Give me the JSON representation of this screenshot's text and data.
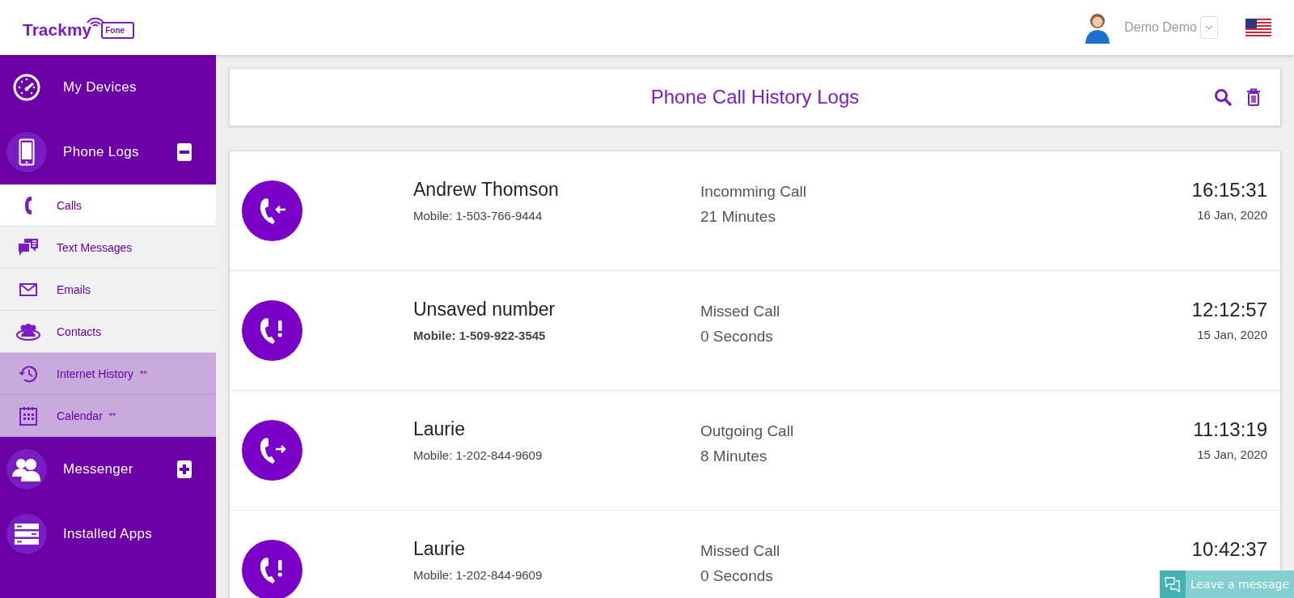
{
  "header": {
    "logo": {
      "text": "Trackmy",
      "badge": "Fone"
    },
    "user": {
      "name": "Demo Demo"
    }
  },
  "sidebar": {
    "sections": [
      {
        "label": "My Devices",
        "kind": "gauge"
      },
      {
        "label": "Phone Logs",
        "kind": "phone",
        "expanded": true,
        "items": [
          {
            "label": "Calls",
            "kind": "handset",
            "selected": true,
            "premium": false
          },
          {
            "label": "Text Messages",
            "kind": "chat",
            "selected": false,
            "premium": false
          },
          {
            "label": "Emails",
            "kind": "mail",
            "selected": false,
            "premium": false
          },
          {
            "label": "Contacts",
            "kind": "contacts",
            "selected": false,
            "premium": false
          },
          {
            "label": "Internet History",
            "kind": "history",
            "selected": false,
            "premium": true,
            "note": "**"
          },
          {
            "label": "Calendar",
            "kind": "calendar",
            "selected": false,
            "premium": true,
            "note": "**"
          }
        ]
      },
      {
        "label": "Messenger",
        "kind": "people",
        "expanded": false
      },
      {
        "label": "Installed Apps",
        "kind": "apps"
      }
    ]
  },
  "page": {
    "title": "Phone Call History Logs"
  },
  "calls": [
    {
      "kind": "incoming",
      "name": "Andrew Thomson",
      "number": "Mobile: 1-503-766-9444",
      "bold_number": false,
      "type": "Incomming Call",
      "duration": "21 Minutes",
      "time": "16:15:31",
      "date": "16 Jan, 2020"
    },
    {
      "kind": "missed",
      "name": "Unsaved number",
      "number": "Mobile: 1-509-922-3545",
      "bold_number": true,
      "type": "Missed Call",
      "duration": "0 Seconds",
      "time": "12:12:57",
      "date": "15 Jan, 2020"
    },
    {
      "kind": "outgoing",
      "name": "Laurie",
      "number": "Mobile: 1-202-844-9609",
      "bold_number": false,
      "type": "Outgoing Call",
      "duration": "8 Minutes",
      "time": "11:13:19",
      "date": "15 Jan, 2020"
    },
    {
      "kind": "missed",
      "name": "Laurie",
      "number": "Mobile: 1-202-844-9609",
      "bold_number": false,
      "type": "Missed Call",
      "duration": "0 Seconds",
      "time": "10:42:37"
    }
  ],
  "chat_widget": {
    "label": "Leave a message"
  }
}
